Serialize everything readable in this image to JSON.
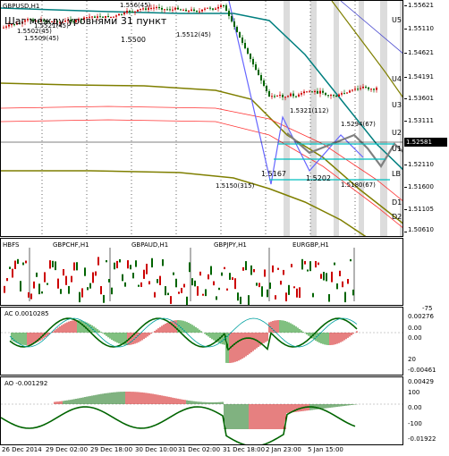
{
  "symbol": "GBPUSD,H1",
  "main_caption": "Шаг между уровнями 31 пункт",
  "price_labels": [
    {
      "text": "1.5502(45)"
    },
    {
      "text": "1.5521(45)"
    },
    {
      "text": "1.5509(45)"
    },
    {
      "text": "1.5500"
    },
    {
      "text": "1.5512(45)"
    },
    {
      "text": "1.556(45)"
    },
    {
      "text": "1.5321(112)"
    },
    {
      "text": "1.5294(67)"
    },
    {
      "text": "1.5150(315)"
    },
    {
      "text": "1.5167"
    },
    {
      "text": "1.5202"
    },
    {
      "text": "1.5180(67)"
    }
  ],
  "levels": [
    {
      "name": "U5",
      "price": "1.55621"
    },
    {
      "name": "U4",
      "price": "1.54191"
    },
    {
      "name": "U3",
      "price": "1.53601"
    },
    {
      "name": "U2",
      "price": "1.52831"
    },
    {
      "name": "U1",
      "price": "1.52581"
    },
    {
      "name": "LB",
      "price": "1.52110"
    },
    {
      "name": "D1",
      "price": "1.51110"
    },
    {
      "name": "D2",
      "price": "1.50610"
    }
  ],
  "price_axis": [
    "1.55621",
    "1.55110",
    "1.54621",
    "1.54191",
    "1.53601",
    "1.53111",
    "1.52581",
    "1.52110",
    "1.51600",
    "1.51105",
    "1.50610"
  ],
  "current_price": "1.52581",
  "hbfs": {
    "label": "HBFS",
    "pairs": [
      "GBPCHF,H1",
      "GBPAUD,H1",
      "GBPJPY,H1",
      "EURGBP,H1"
    ]
  },
  "ac": {
    "label": "AC 0.0010285",
    "axis": [
      "0.00276",
      "0.00",
      "0.00",
      "-0.00461"
    ],
    "side": [
      "-75",
      "20"
    ]
  },
  "ao": {
    "label": "AO -0.001292",
    "axis": [
      "0.00429",
      "100",
      "0.00",
      "-100",
      "-0.01922"
    ]
  },
  "time_axis": [
    "26 Dec 2014",
    "29 Dec 02:00",
    "29 Dec 18:00",
    "30 Dec 10:00",
    "31 Dec 02:00",
    "31 Dec 18:00",
    "2 Jan 23:00",
    "5 Jan 15:00"
  ],
  "colors": {
    "bull": "#cc0000",
    "bear": "#006400",
    "teal": "#007f7f",
    "olive": "#7f7f00",
    "red": "#ff3333",
    "blue": "#5050d0"
  }
}
